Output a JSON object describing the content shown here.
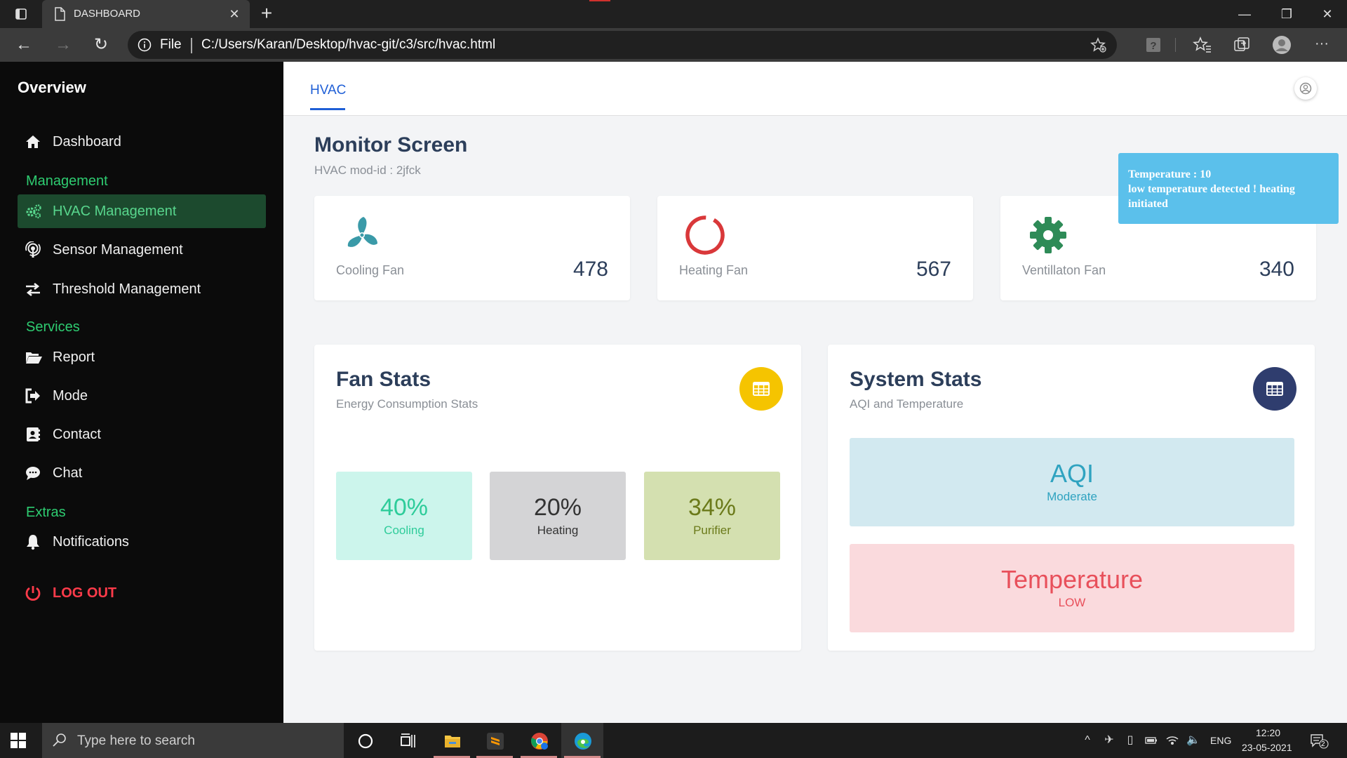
{
  "browser": {
    "tab_title": "DASHBOARD",
    "address_prefix": "File",
    "url": "C:/Users/Karan/Desktop/hvac-git/c3/src/hvac.html"
  },
  "sidebar": {
    "brand": "Overview",
    "dashboard": "Dashboard",
    "section_management": "Management",
    "hvac_management": "HVAC Management",
    "sensor_management": "Sensor Management",
    "threshold_management": "Threshold Management",
    "section_services": "Services",
    "report": "Report",
    "mode": "Mode",
    "contact": "Contact",
    "chat": "Chat",
    "section_extras": "Extras",
    "notifications": "Notifications",
    "logout": "LOG OUT"
  },
  "topnav": {
    "tab": "HVAC"
  },
  "page": {
    "title": "Monitor Screen",
    "subtitle": "HVAC mod-id : 2jfck"
  },
  "fans": [
    {
      "label": "Cooling Fan",
      "value": "478",
      "color": "#3a9aa8"
    },
    {
      "label": "Heating Fan",
      "value": "567",
      "color": "#d9383a"
    },
    {
      "label": "Ventillaton Fan",
      "value": "340",
      "color": "#2e8b57"
    }
  ],
  "fan_stats": {
    "title": "Fan Stats",
    "subtitle": "Energy Consumption Stats",
    "button_color": "#f5c400",
    "tiles": [
      {
        "value": "40%",
        "label": "Cooling",
        "bg": "#ccf5ec",
        "fg": "#2ecc9a"
      },
      {
        "value": "20%",
        "label": "Heating",
        "bg": "#d4d4d6",
        "fg": "#333333"
      },
      {
        "value": "34%",
        "label": "Purifier",
        "bg": "#d4e0b0",
        "fg": "#6b7a1a"
      }
    ]
  },
  "system_stats": {
    "title": "System Stats",
    "subtitle": "AQI and Temperature",
    "button_color": "#2f3d6e",
    "aqi": {
      "value": "AQI",
      "label": "Moderate",
      "bg": "#d2e9f0",
      "fg": "#2fa3c0"
    },
    "temperature": {
      "value": "Temperature",
      "label": "LOW",
      "bg": "#fadadd",
      "fg": "#e8505b"
    }
  },
  "toast": {
    "line1": "Temperature : 10",
    "line2": "low temperature detected ! heating initiated"
  },
  "taskbar": {
    "search_placeholder": "Type here to search",
    "language": "ENG",
    "time": "12:20",
    "date": "23-05-2021",
    "notification_count": "2"
  }
}
